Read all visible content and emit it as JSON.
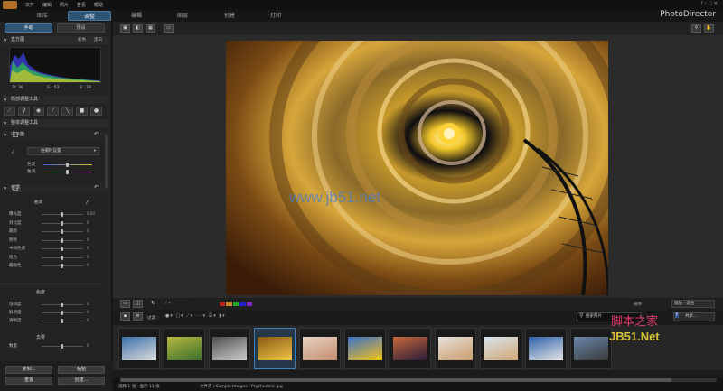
{
  "menu": {
    "items": [
      "文件",
      "编辑",
      "照片",
      "查看",
      "帮助"
    ]
  },
  "tabs": [
    {
      "label": "图库"
    },
    {
      "label": "调整"
    },
    {
      "label": "编辑"
    },
    {
      "label": "图层"
    },
    {
      "label": "创建"
    },
    {
      "label": "打印"
    }
  ],
  "brand": "PhotoDirector",
  "window_controls": "?  –  ▢  ✕",
  "left": {
    "tabs": [
      "手动",
      "预设"
    ],
    "histogram": {
      "title": "直方图",
      "modes": [
        "彩色",
        "黑白"
      ],
      "rgb": [
        "R: 36",
        "G : 62",
        "B : 26"
      ]
    },
    "region_tools": "局部调整工具",
    "global_tools": "整体调整工具",
    "white_balance": {
      "title": "白平衡",
      "preset": "拍摄时设置",
      "sliders": [
        {
          "label": "色温"
        },
        {
          "label": "色调"
        }
      ]
    },
    "tone": {
      "title": "色调",
      "subtitle": "曲调",
      "sliders": [
        {
          "label": "曝光度",
          "value": "0.00"
        },
        {
          "label": "对比度",
          "value": "0"
        },
        {
          "label": "最亮",
          "value": "0"
        },
        {
          "label": "明亮",
          "value": "0"
        },
        {
          "label": "中间色调",
          "value": "0"
        },
        {
          "label": "暗色",
          "value": "0"
        },
        {
          "label": "最暗色",
          "value": "0"
        }
      ]
    },
    "color": {
      "title": "色度",
      "sliders": [
        {
          "label": "饱和度",
          "value": "0"
        },
        {
          "label": "鲜艳度",
          "value": "0"
        },
        {
          "label": "清晰度",
          "value": "0"
        }
      ]
    },
    "sharpen": {
      "title": "去雾",
      "sliders": [
        {
          "label": "数量",
          "value": "0"
        }
      ]
    },
    "buttons": [
      "复制...",
      "粘贴",
      "重置",
      "创建..."
    ]
  },
  "filterbar": {
    "filter_label": "过滤 :",
    "search_placeholder": "搜索照片",
    "share_label": "共享...",
    "sort_label": "排序",
    "zoom_label": "缩放 : 适合"
  },
  "watermark": {
    "text": "www.jb51.net",
    "site_cn": "脚本之家",
    "site_en": "JB51.Net"
  },
  "thumbnails": [
    {
      "color": "#3a6fa8",
      "accent": "#dedede"
    },
    {
      "color": "#b7b840",
      "accent": "#3b6e2a"
    },
    {
      "color": "#4d4d4d",
      "accent": "#cfcfcf"
    },
    {
      "color": "#8a5a12",
      "accent": "#f0c34a"
    },
    {
      "color": "#e7d3c4",
      "accent": "#c48a6a"
    },
    {
      "color": "#3a6fc8",
      "accent": "#f4c21a"
    },
    {
      "color": "#c86a3a",
      "accent": "#2a1a3a"
    },
    {
      "color": "#e8e2dc",
      "accent": "#c89a6a"
    },
    {
      "color": "#d8e4ee",
      "accent": "#d2a873"
    },
    {
      "color": "#2b5fa8",
      "accent": "#e7e7e7"
    },
    {
      "color": "#6a86aa",
      "accent": "#3a3a3a"
    }
  ],
  "selected_thumb": 3,
  "status": {
    "selection": "选择 1 张 · 显示 11 张",
    "path": "文件夹 / Sample Images / Psychedelic.jpg"
  },
  "colors": {
    "accent": "#2f5572",
    "selection": "#3d7fb8"
  }
}
